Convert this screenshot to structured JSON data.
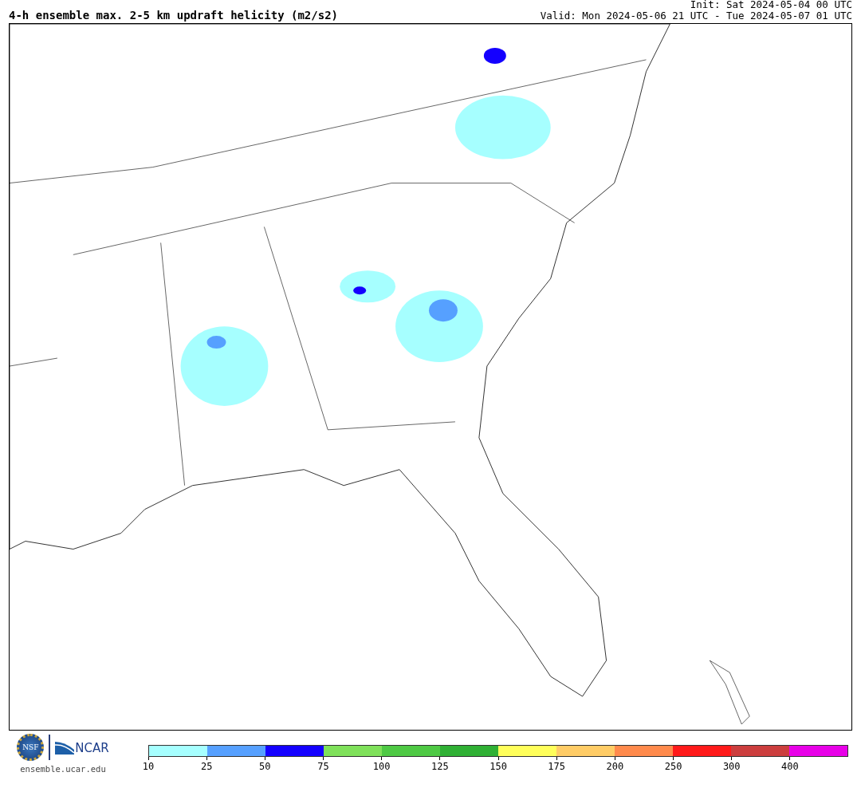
{
  "title": "4-h ensemble max. 2-5 km updraft helicity (m2/s2)",
  "init": "Init: Sat 2024-05-04 00 UTC",
  "valid": "Valid: Mon 2024-05-06 21 UTC - Tue 2024-05-07 01 UTC",
  "logos": {
    "nsf": "NSF",
    "ncar": "NCAR",
    "site": "ensemble.ucar.edu"
  },
  "colorbar": [
    {
      "color": "#a6ffff",
      "label": "10"
    },
    {
      "color": "#56a0ff",
      "label": "25"
    },
    {
      "color": "#1400ff",
      "label": "50"
    },
    {
      "color": "#7fe15a",
      "label": "75"
    },
    {
      "color": "#4ec944",
      "label": "100"
    },
    {
      "color": "#2fb034",
      "label": "125"
    },
    {
      "color": "#ffff5a",
      "label": "150"
    },
    {
      "color": "#ffcc66",
      "label": "175"
    },
    {
      "color": "#ff8a4c",
      "label": "200"
    },
    {
      "color": "#ff1a1a",
      "label": "250"
    },
    {
      "color": "#cc3e3e",
      "label": "300"
    },
    {
      "color": "#e800e8",
      "label": "400"
    }
  ]
}
